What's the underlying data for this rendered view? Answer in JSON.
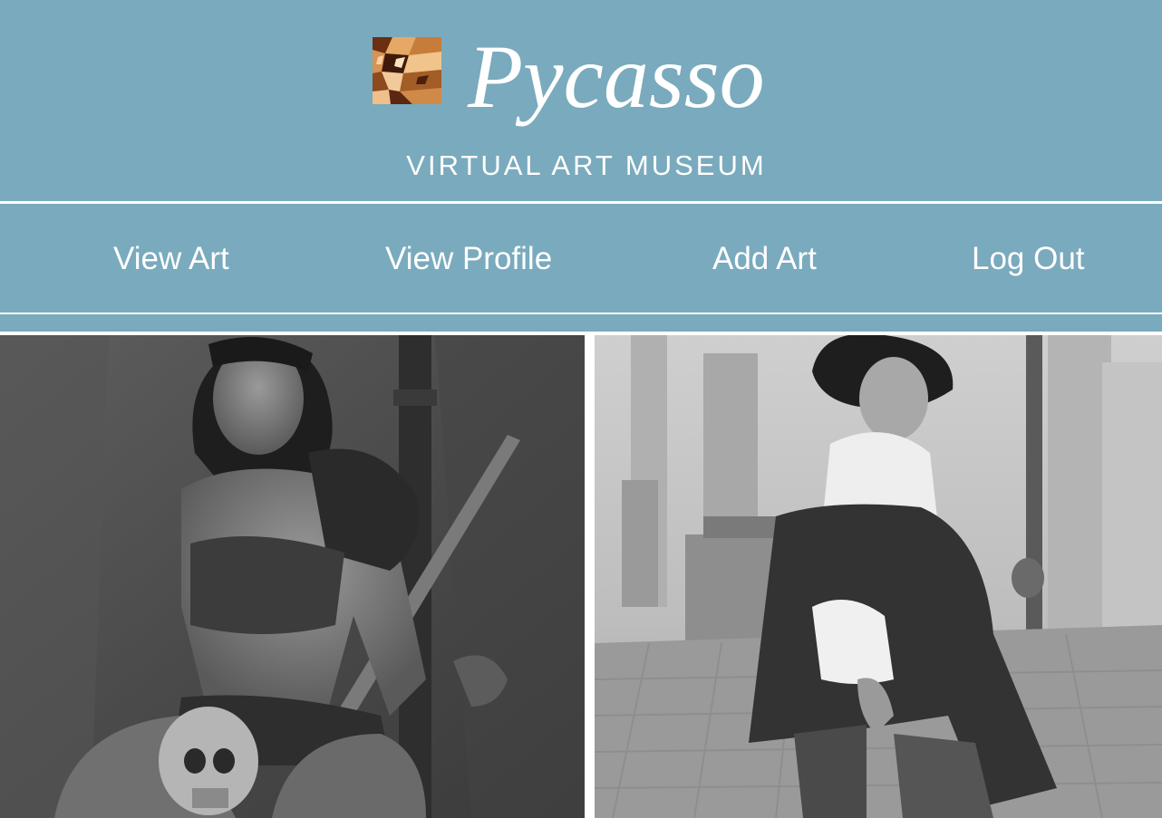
{
  "header": {
    "title": "Pycasso",
    "subtitle": "VIRTUAL ART MUSEUM",
    "logo_icon": "abstract-cubist-logo-icon"
  },
  "nav": {
    "items": [
      {
        "label": "View Art"
      },
      {
        "label": "View Profile"
      },
      {
        "label": "Add Art"
      },
      {
        "label": "Log Out"
      }
    ]
  },
  "gallery": {
    "artworks": [
      {
        "subject": "seated-armored-woman-with-skull-and-staff"
      },
      {
        "subject": "smiling-figure-in-hat-and-cloak-on-street"
      }
    ]
  },
  "colors": {
    "header_bg": "#7aaabd",
    "text": "#ffffff",
    "divider": "#ffffff"
  }
}
